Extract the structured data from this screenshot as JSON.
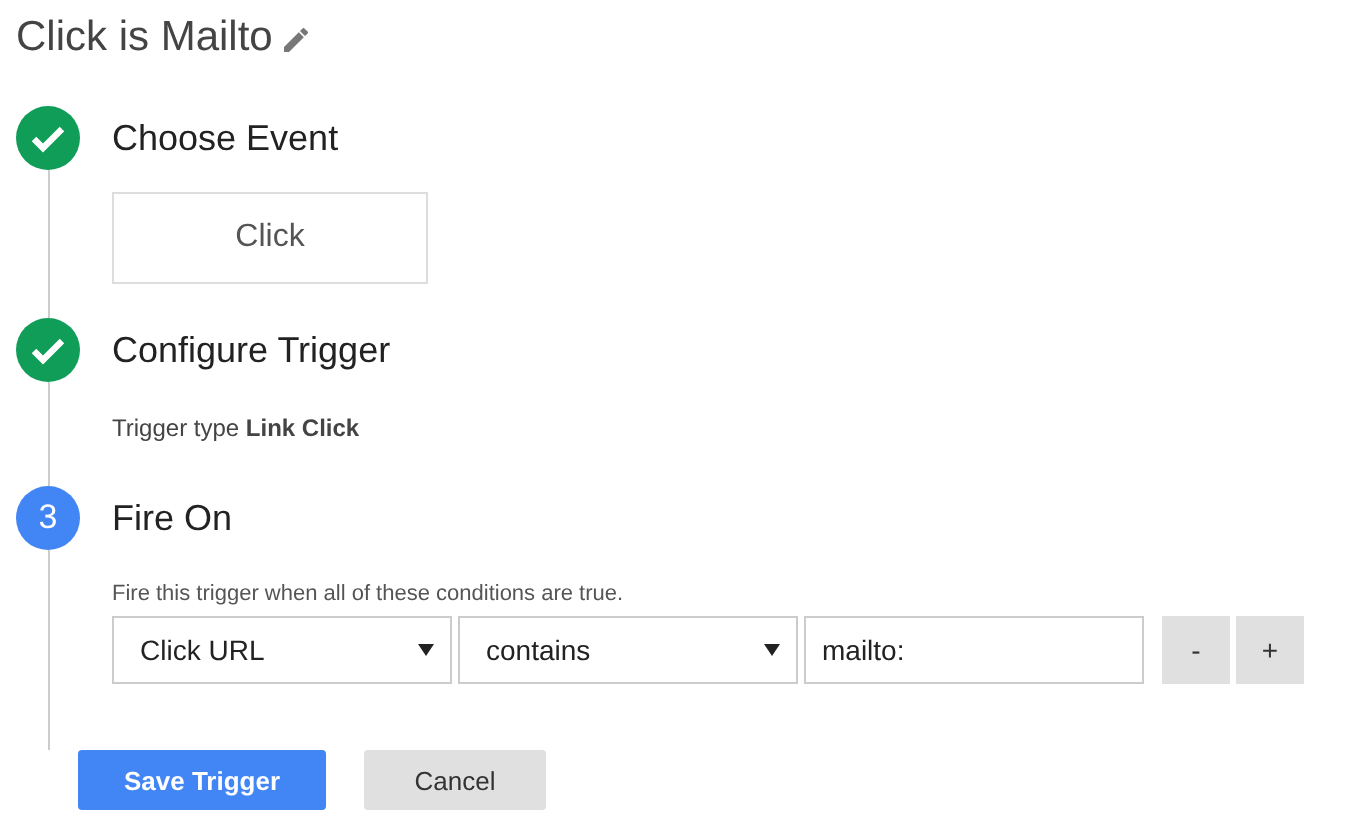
{
  "title": "Click is Mailto",
  "steps": [
    {
      "kind": "done",
      "title": "Choose Event",
      "event_choice": "Click"
    },
    {
      "kind": "done",
      "title": "Configure Trigger",
      "summary": "Trigger type **Link Click**"
    },
    {
      "kind": "numbered",
      "number": "3",
      "title": "Fire On",
      "description": "Fire this trigger when all of these conditions are true.",
      "condition": {
        "variable": "Click URL",
        "operator": "contains",
        "value": "mailto:",
        "remove": "-",
        "add": "+"
      }
    }
  ],
  "buttons": [
    {
      "label": "Save Trigger",
      "kind": "primary"
    },
    {
      "label": "Cancel",
      "kind": "secondary"
    }
  ]
}
